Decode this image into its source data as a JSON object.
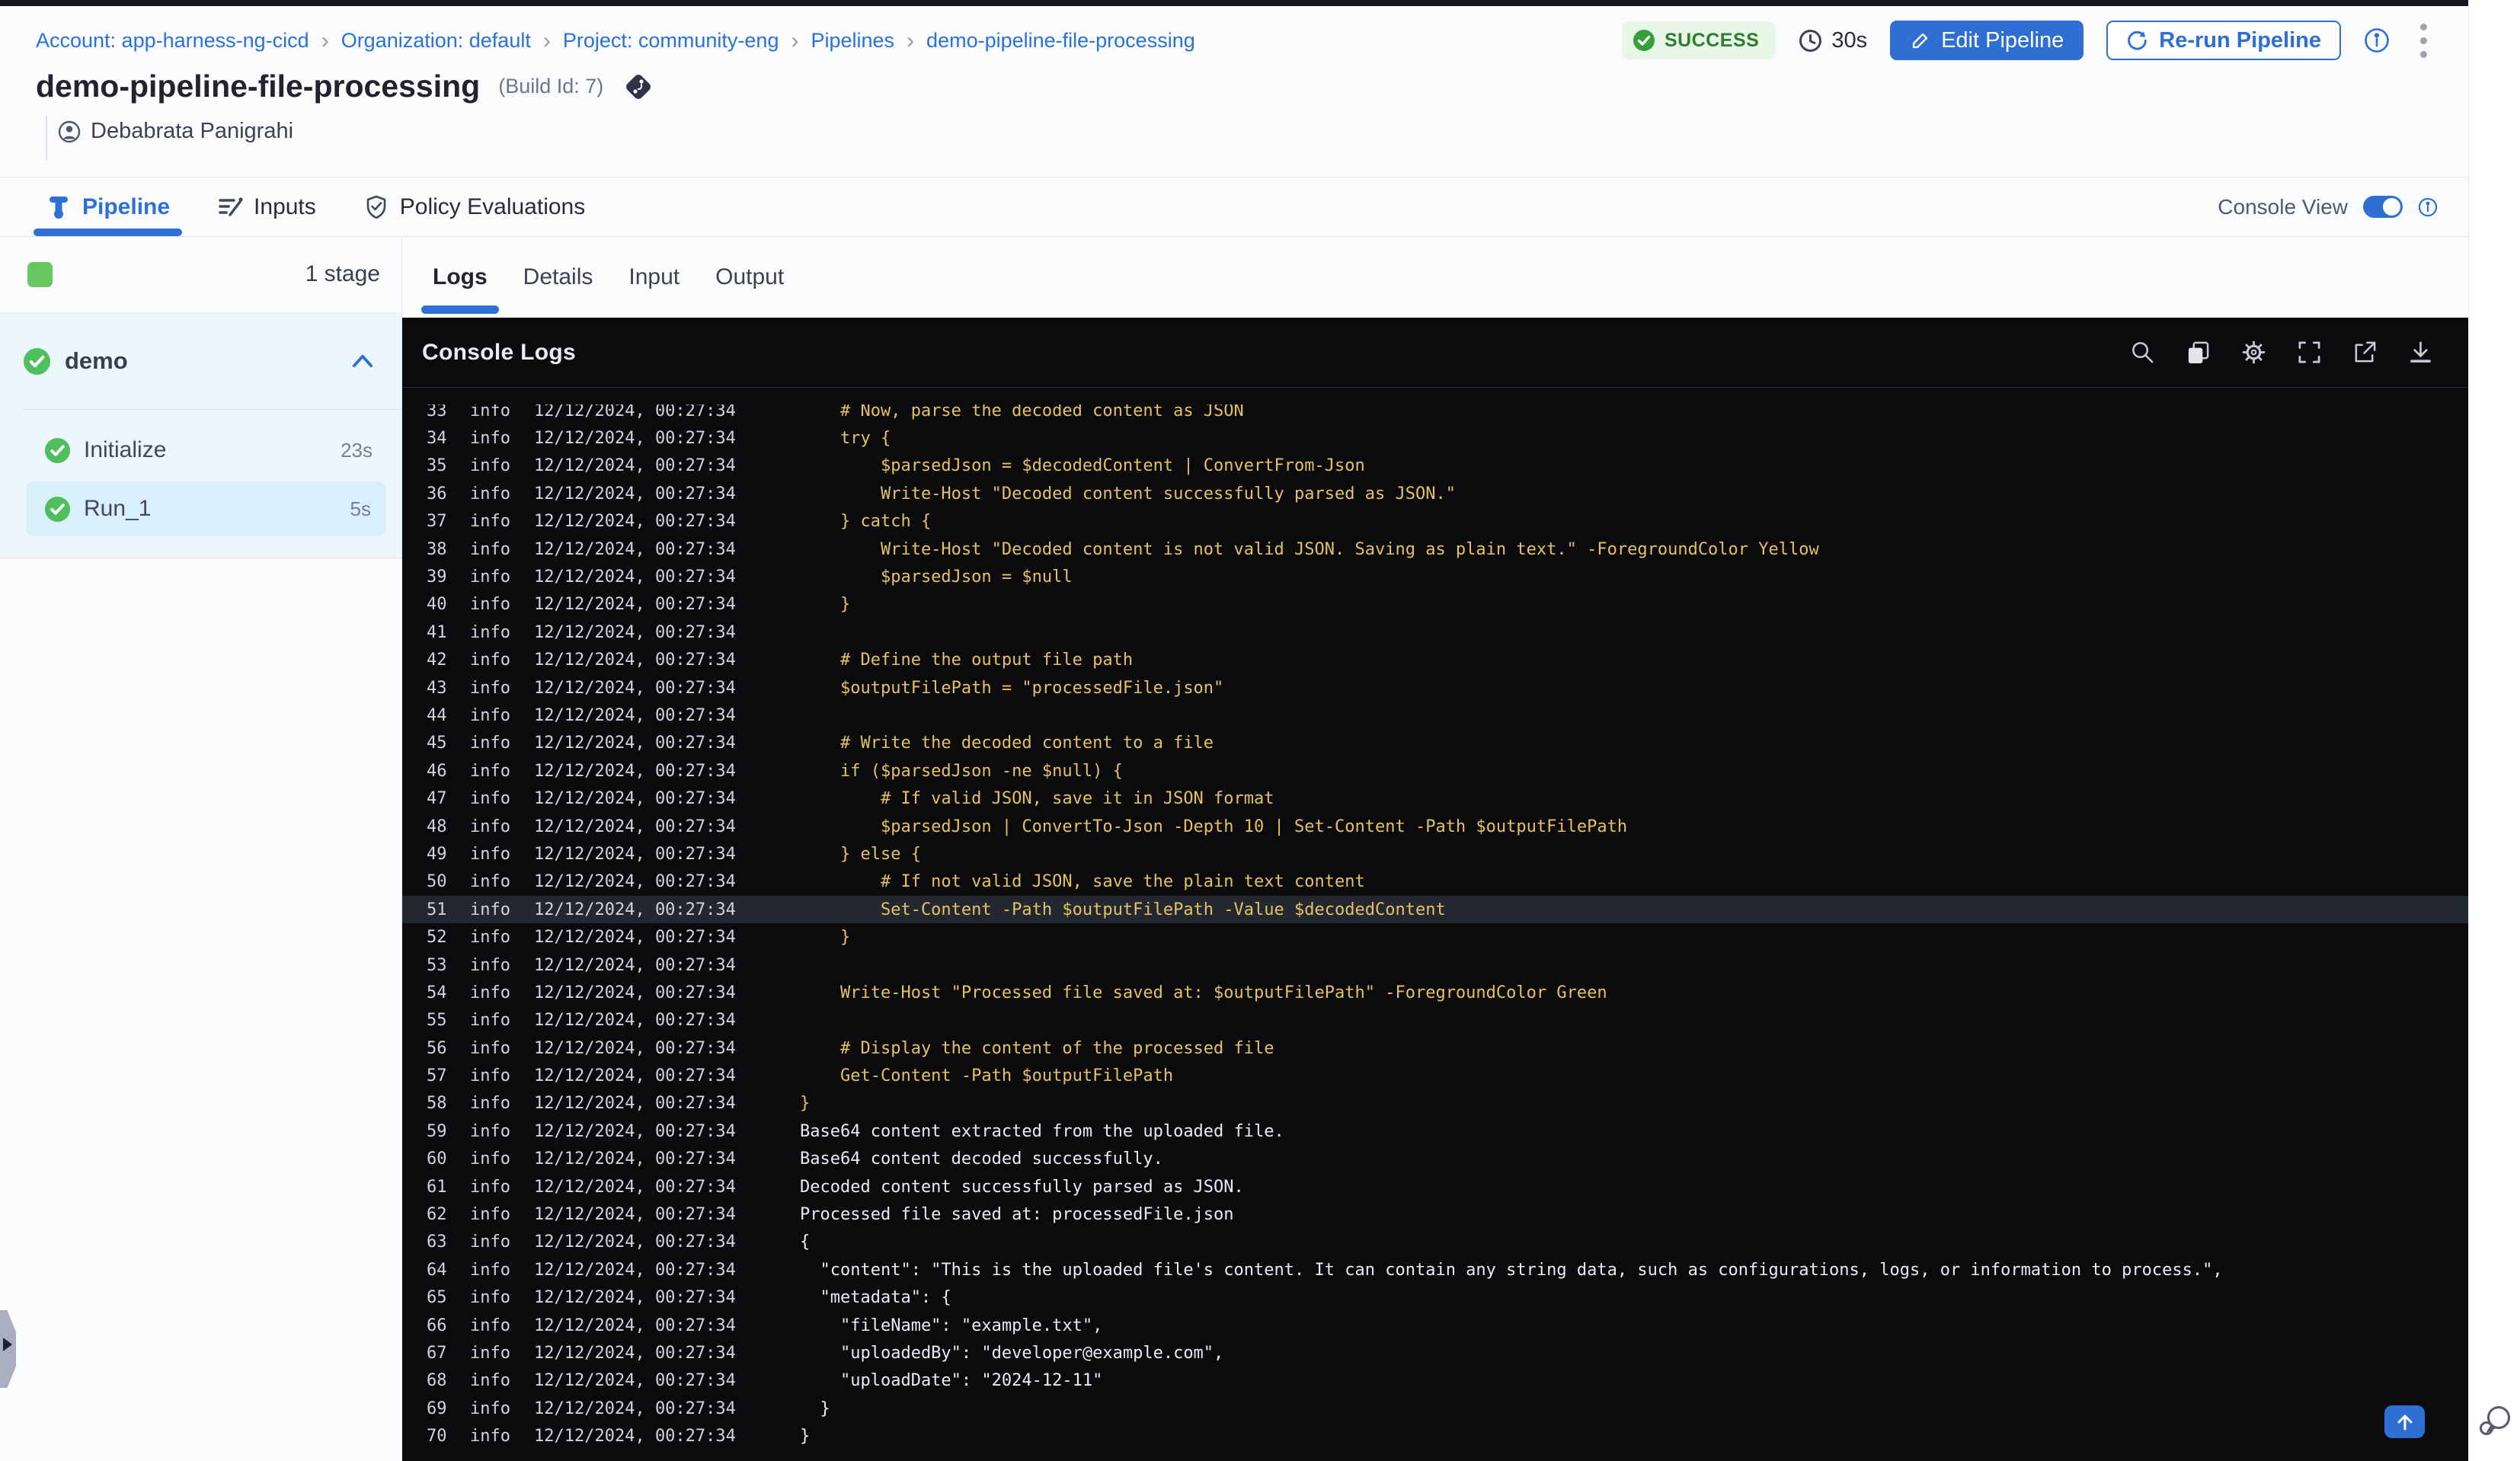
{
  "breadcrumb": {
    "separator": "›",
    "items": [
      "Account: app-harness-ng-cicd",
      "Organization: default",
      "Project: community-eng",
      "Pipelines",
      "demo-pipeline-file-processing"
    ]
  },
  "header": {
    "title": "demo-pipeline-file-processing",
    "build_id": "(Build Id: 7)",
    "author": "Debabrata Panigrahi",
    "status_label": "SUCCESS",
    "duration": "30s",
    "edit_button": "Edit Pipeline",
    "rerun_button": "Re-run Pipeline"
  },
  "nav_tabs": [
    {
      "label": "Pipeline",
      "active": true
    },
    {
      "label": "Inputs",
      "active": false
    },
    {
      "label": "Policy Evaluations",
      "active": false
    }
  ],
  "console_view": {
    "label": "Console View",
    "enabled": true
  },
  "sidebar": {
    "stage_count": "1 stage",
    "group": {
      "name": "demo",
      "status": "success"
    },
    "steps": [
      {
        "name": "Initialize",
        "duration": "23s",
        "selected": false
      },
      {
        "name": "Run_1",
        "duration": "5s",
        "selected": true
      }
    ]
  },
  "log_tabs": [
    {
      "label": "Logs",
      "active": true
    },
    {
      "label": "Details",
      "active": false
    },
    {
      "label": "Input",
      "active": false
    },
    {
      "label": "Output",
      "active": false
    }
  ],
  "console": {
    "title": "Console Logs",
    "icons": [
      "search",
      "copy",
      "settings",
      "fullscreen",
      "open-in-new",
      "download"
    ],
    "scroll_top_icon": "arrow-up"
  },
  "logs": {
    "level": "info",
    "timestamp": "12/12/2024, 00:27:34",
    "highlight_line": 51,
    "lines": [
      {
        "n": 33,
        "kind": "code",
        "msg": "    # Now, parse the decoded content as JSON"
      },
      {
        "n": 34,
        "kind": "code",
        "msg": "    try {"
      },
      {
        "n": 35,
        "kind": "code",
        "msg": "        $parsedJson = $decodedContent | ConvertFrom-Json"
      },
      {
        "n": 36,
        "kind": "code",
        "msg": "        Write-Host \"Decoded content successfully parsed as JSON.\""
      },
      {
        "n": 37,
        "kind": "code",
        "msg": "    } catch {"
      },
      {
        "n": 38,
        "kind": "code",
        "msg": "        Write-Host \"Decoded content is not valid JSON. Saving as plain text.\" -ForegroundColor Yellow"
      },
      {
        "n": 39,
        "kind": "code",
        "msg": "        $parsedJson = $null"
      },
      {
        "n": 40,
        "kind": "code",
        "msg": "    }"
      },
      {
        "n": 41,
        "kind": "code",
        "msg": ""
      },
      {
        "n": 42,
        "kind": "code",
        "msg": "    # Define the output file path"
      },
      {
        "n": 43,
        "kind": "code",
        "msg": "    $outputFilePath = \"processedFile.json\""
      },
      {
        "n": 44,
        "kind": "code",
        "msg": ""
      },
      {
        "n": 45,
        "kind": "code",
        "msg": "    # Write the decoded content to a file"
      },
      {
        "n": 46,
        "kind": "code",
        "msg": "    if ($parsedJson -ne $null) {"
      },
      {
        "n": 47,
        "kind": "code",
        "msg": "        # If valid JSON, save it in JSON format"
      },
      {
        "n": 48,
        "kind": "code",
        "msg": "        $parsedJson | ConvertTo-Json -Depth 10 | Set-Content -Path $outputFilePath"
      },
      {
        "n": 49,
        "kind": "code",
        "msg": "    } else {"
      },
      {
        "n": 50,
        "kind": "code",
        "msg": "        # If not valid JSON, save the plain text content"
      },
      {
        "n": 51,
        "kind": "code",
        "msg": "        Set-Content -Path $outputFilePath -Value $decodedContent"
      },
      {
        "n": 52,
        "kind": "code",
        "msg": "    }"
      },
      {
        "n": 53,
        "kind": "code",
        "msg": ""
      },
      {
        "n": 54,
        "kind": "code",
        "msg": "    Write-Host \"Processed file saved at: $outputFilePath\" -ForegroundColor Green"
      },
      {
        "n": 55,
        "kind": "code",
        "msg": ""
      },
      {
        "n": 56,
        "kind": "code",
        "msg": "    # Display the content of the processed file"
      },
      {
        "n": 57,
        "kind": "code",
        "msg": "    Get-Content -Path $outputFilePath"
      },
      {
        "n": 58,
        "kind": "code",
        "msg": "}"
      },
      {
        "n": 59,
        "kind": "out",
        "msg": "Base64 content extracted from the uploaded file."
      },
      {
        "n": 60,
        "kind": "out",
        "msg": "Base64 content decoded successfully."
      },
      {
        "n": 61,
        "kind": "out",
        "msg": "Decoded content successfully parsed as JSON."
      },
      {
        "n": 62,
        "kind": "out",
        "msg": "Processed file saved at: processedFile.json"
      },
      {
        "n": 63,
        "kind": "out",
        "msg": "{"
      },
      {
        "n": 64,
        "kind": "out",
        "msg": "  \"content\": \"This is the uploaded file's content. It can contain any string data, such as configurations, logs, or information to process.\","
      },
      {
        "n": 65,
        "kind": "out",
        "msg": "  \"metadata\": {"
      },
      {
        "n": 66,
        "kind": "out",
        "msg": "    \"fileName\": \"example.txt\","
      },
      {
        "n": 67,
        "kind": "out",
        "msg": "    \"uploadedBy\": \"developer@example.com\","
      },
      {
        "n": 68,
        "kind": "out",
        "msg": "    \"uploadDate\": \"2024-12-11\""
      },
      {
        "n": 69,
        "kind": "out",
        "msg": "  }"
      },
      {
        "n": 70,
        "kind": "out",
        "msg": "}"
      }
    ]
  },
  "colors": {
    "accent_blue": "#2e6fd4",
    "link_blue": "#2b72d6",
    "success_green": "#35a03a",
    "success_text": "#2e7d32",
    "success_bg": "#e8f6e8",
    "stage_green": "#68c763",
    "group_bg": "#ebf7fa",
    "selected_step_bg": "#d8f0fa",
    "console_bg": "#0b0b0e",
    "log_code_yellow": "#e3c164",
    "log_text_white": "#e9ebee",
    "log_meta_gray": "#d2d4da",
    "highlight_row_bg": "#232830"
  }
}
